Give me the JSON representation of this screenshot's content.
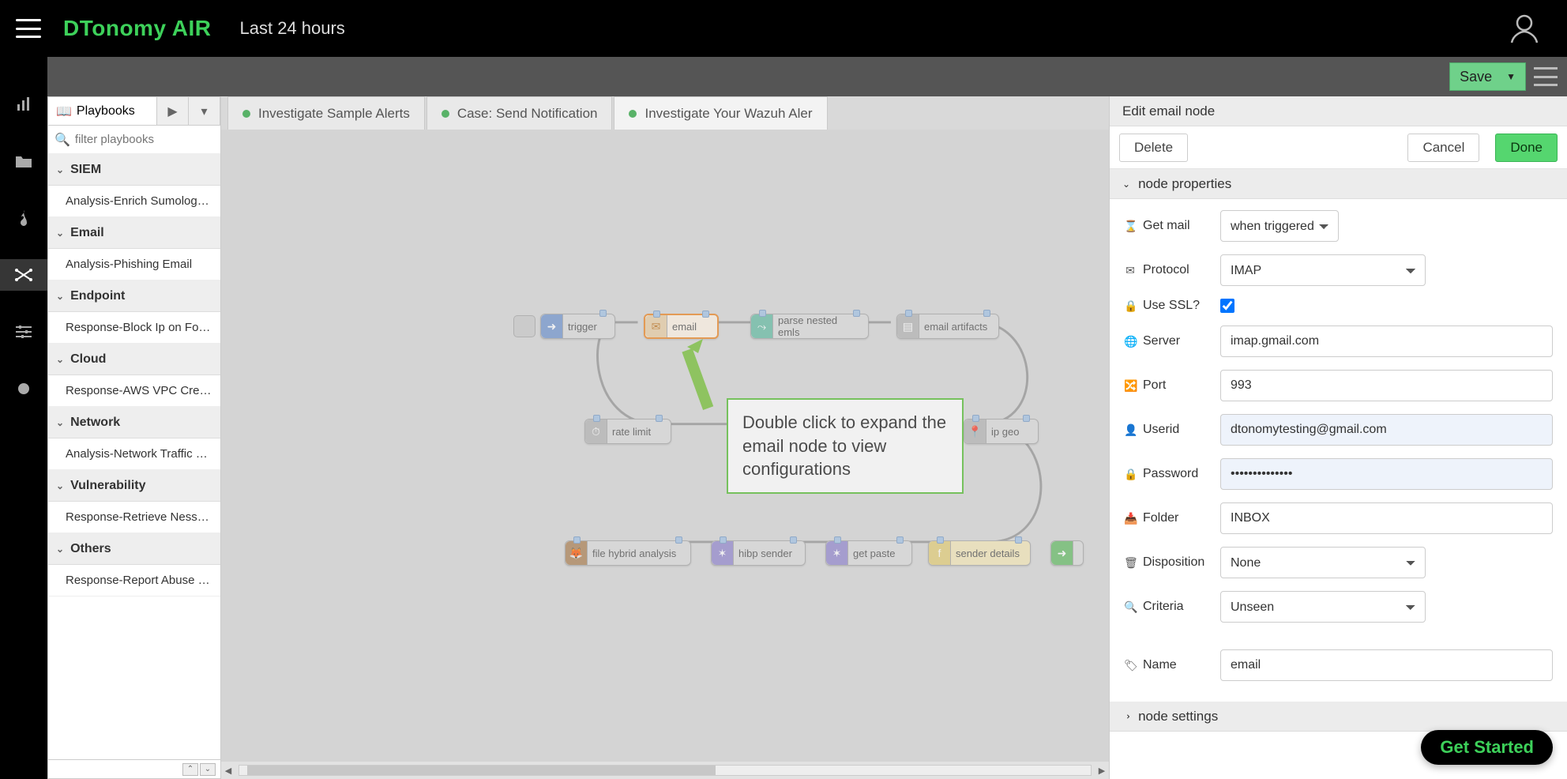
{
  "header": {
    "brand": "DTonomy AIR",
    "timerange": "Last 24 hours"
  },
  "toolbar": {
    "save_label": "Save"
  },
  "sidebar": {
    "tab_label": "Playbooks",
    "filter_placeholder": "filter playbooks",
    "groups": [
      {
        "name": "SIEM",
        "items": [
          "Analysis-Enrich Sumolog…"
        ]
      },
      {
        "name": "Email",
        "items": [
          "Analysis-Phishing Email"
        ]
      },
      {
        "name": "Endpoint",
        "items": [
          "Response-Block Ip on Fo…"
        ]
      },
      {
        "name": "Cloud",
        "items": [
          "Response-AWS VPC Cre…"
        ]
      },
      {
        "name": "Network",
        "items": [
          "Analysis-Network Traffic …"
        ]
      },
      {
        "name": "Vulnerability",
        "items": [
          "Response-Retrieve Ness…"
        ]
      },
      {
        "name": "Others",
        "items": [
          "Response-Report Abuse …"
        ]
      }
    ]
  },
  "canvas": {
    "tabs": [
      {
        "label": "Investigate Sample Alerts",
        "green": true
      },
      {
        "label": "Case: Send Notification",
        "green": true
      },
      {
        "label": "Investigate Your Wazuh Aler",
        "green": true,
        "active": true
      }
    ],
    "callout": "Double click to expand the email node to view configurations",
    "nodes": {
      "trigger": "trigger",
      "email": "email",
      "parse": "parse nested emls",
      "artifacts": "email artifacts",
      "ratelimit": "rate limit",
      "ipgeo": "ip geo",
      "filehybrid": "file hybrid analysis",
      "hibp": "hibp sender",
      "getpaste": "get paste",
      "senderdetails": "sender details"
    }
  },
  "rightpanel": {
    "title": "Edit email node",
    "delete": "Delete",
    "cancel": "Cancel",
    "done": "Done",
    "section_props": "node properties",
    "section_settings": "node settings",
    "fields": {
      "getmail_label": "Get mail",
      "getmail_value": "when triggered",
      "protocol_label": "Protocol",
      "protocol_value": "IMAP",
      "usessl_label": "Use SSL?",
      "usessl_checked": true,
      "server_label": "Server",
      "server_value": "imap.gmail.com",
      "port_label": "Port",
      "port_value": "993",
      "userid_label": "Userid",
      "userid_value": "dtonomytesting@gmail.com",
      "password_label": "Password",
      "password_value": "••••••••••••••",
      "folder_label": "Folder",
      "folder_value": "INBOX",
      "disposition_label": "Disposition",
      "disposition_value": "None",
      "criteria_label": "Criteria",
      "criteria_value": "Unseen",
      "name_label": "Name",
      "name_value": "email"
    }
  },
  "getstarted": "Get Started"
}
